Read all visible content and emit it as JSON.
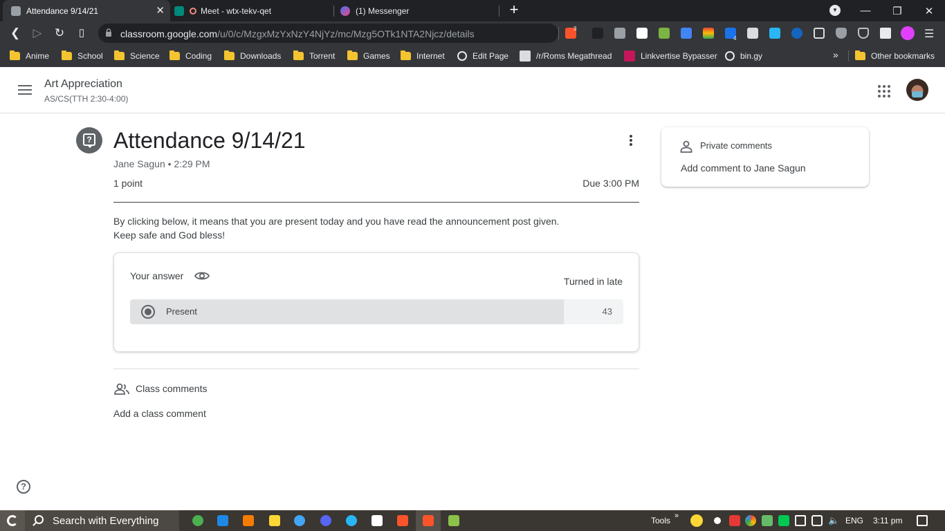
{
  "browser": {
    "tabs": [
      {
        "title": "Attendance 9/14/21",
        "active": true
      },
      {
        "title": "Meet - wtx-tekv-qet",
        "active": false
      },
      {
        "title": "(1) Messenger",
        "active": false
      }
    ],
    "url_host": "classroom.google.com",
    "url_path": "/u/0/c/MzgxMzYxNzY4NjYz/mc/Mzg5OTk1NTA2Njcz/details",
    "brave_badge": "3",
    "ext_badge": "4",
    "bookmarks": [
      {
        "label": "Anime",
        "type": "folder"
      },
      {
        "label": "School",
        "type": "folder"
      },
      {
        "label": "Science",
        "type": "folder"
      },
      {
        "label": "Coding",
        "type": "folder"
      },
      {
        "label": "Downloads",
        "type": "folder"
      },
      {
        "label": "Torrent",
        "type": "folder"
      },
      {
        "label": "Games",
        "type": "folder"
      },
      {
        "label": "Internet",
        "type": "folder"
      },
      {
        "label": "Edit Page",
        "type": "globe"
      },
      {
        "label": "/r/Roms Megathread",
        "type": "site"
      },
      {
        "label": "Linkvertise Bypasser",
        "type": "site"
      },
      {
        "label": "bin.gy",
        "type": "globe"
      }
    ],
    "overflow": "»",
    "other_bookmarks": "Other bookmarks"
  },
  "classroom": {
    "class_name": "Art Appreciation",
    "class_section": "AS/CS(TTH 2:30-4:00)",
    "post_title": "Attendance 9/14/21",
    "post_meta": "Jane Sagun • 2:29 PM",
    "points": "1 point",
    "due": "Due 3:00 PM",
    "description_line1": "By clicking below, it means that you are present today and you have read the announcement post given.",
    "description_line2": "Keep safe and God bless!",
    "answer": {
      "label": "Your answer",
      "status": "Turned in late",
      "option_label": "Present",
      "option_count": "43",
      "option_fill_fraction": 0.88
    },
    "class_comments_label": "Class comments",
    "add_class_comment": "Add a class comment",
    "private_comments_label": "Private comments",
    "add_private_comment": "Add comment to Jane Sagun",
    "help_symbol": "?"
  },
  "taskbar": {
    "search_text": "Search with Everything",
    "tools_label": "Tools",
    "tools_chevron": "»",
    "language": "ENG",
    "time": "3:11 pm"
  },
  "icons": {
    "lock": "lock-icon",
    "eye": "eye-icon",
    "people": "people-icon",
    "person": "person-icon",
    "question": "question-icon",
    "help": "help-icon"
  }
}
